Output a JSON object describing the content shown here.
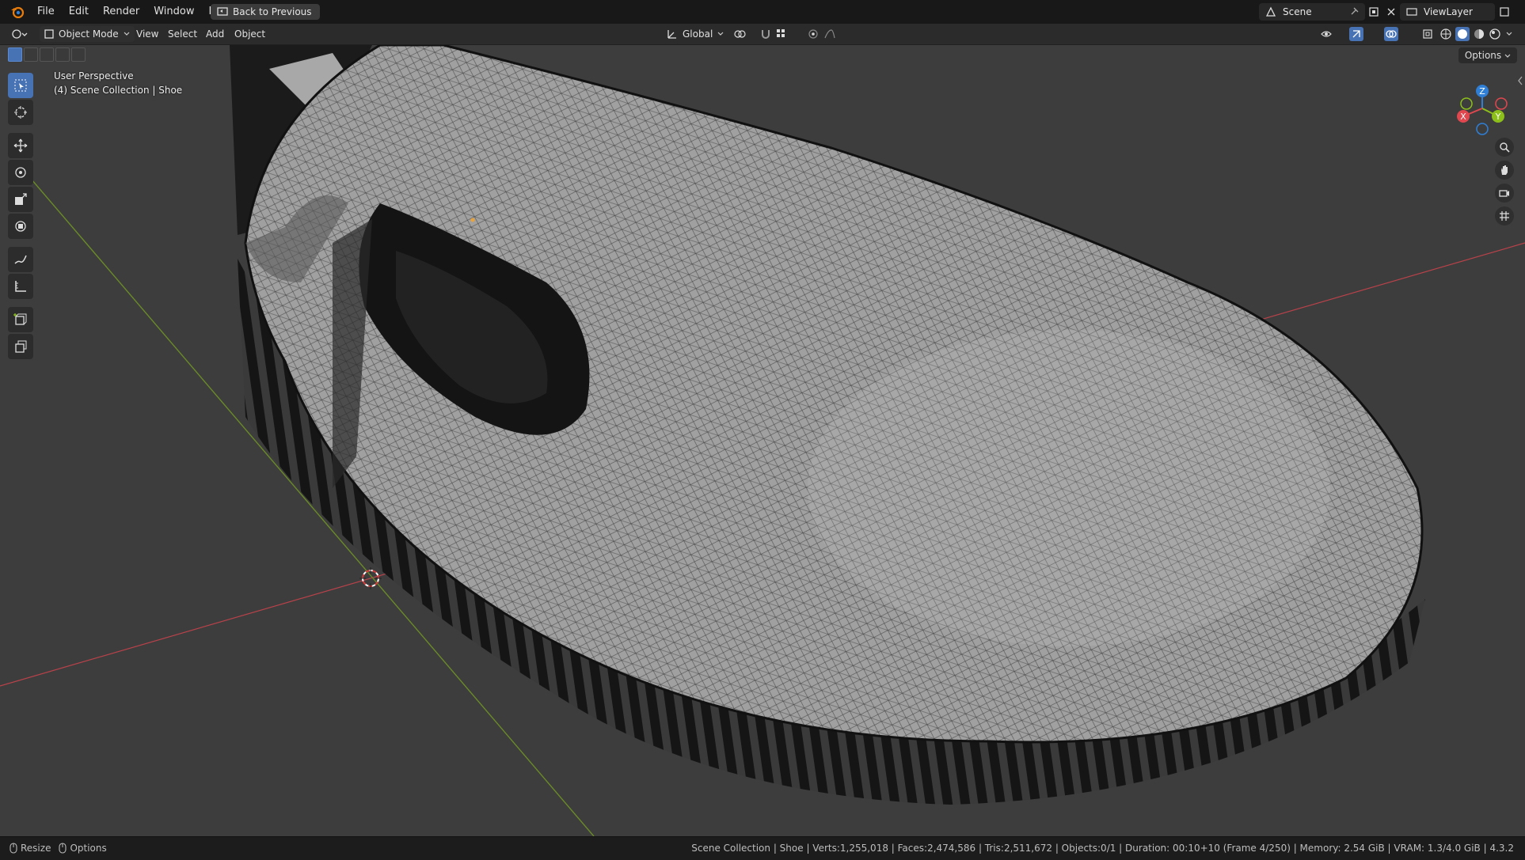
{
  "menu": {
    "items": [
      "File",
      "Edit",
      "Render",
      "Window",
      "Help"
    ],
    "back_button": "Back to Previous"
  },
  "workspace": {
    "scene_label": "Scene",
    "view_layer_label": "ViewLayer"
  },
  "header": {
    "mode": "Object Mode",
    "menus": [
      "View",
      "Select",
      "Add",
      "Object"
    ],
    "transform_orientation": "Global",
    "options_label": "Options"
  },
  "viewport": {
    "perspective_label": "User Perspective",
    "collection_label": "(4) Scene Collection | Shoe",
    "gizmo_axes": {
      "x": "X",
      "y": "Y",
      "z": "Z"
    }
  },
  "status": {
    "left_items": [
      {
        "icon": "mouse-icon",
        "label": "Resize"
      },
      {
        "icon": "mouse-icon",
        "label": "Options"
      }
    ],
    "stats": "Scene Collection | Shoe | Verts:1,255,018 | Faces:2,474,586 | Tris:2,511,672 | Objects:0/1 | Duration: 00:10+10 (Frame 4/250) | Memory: 2.54 GiB | VRAM: 1.3/4.0 GiB | 4.3.2"
  },
  "colors": {
    "axis_x": "#b8424a",
    "axis_y": "#6a8a28",
    "gizmo_x": "#e0474f",
    "gizmo_y": "#8cbf1a",
    "gizmo_z": "#2f7fd6",
    "active_tool": "#4772b3",
    "mesh_fill": "#9a9a9a"
  },
  "toolbar": {
    "tools": [
      "select-box-icon",
      "cursor-icon",
      "move-icon",
      "rotate-icon",
      "scale-icon",
      "transform-icon",
      "annotate-icon",
      "measure-icon",
      "add-cube-icon",
      "extrude-icon"
    ]
  }
}
